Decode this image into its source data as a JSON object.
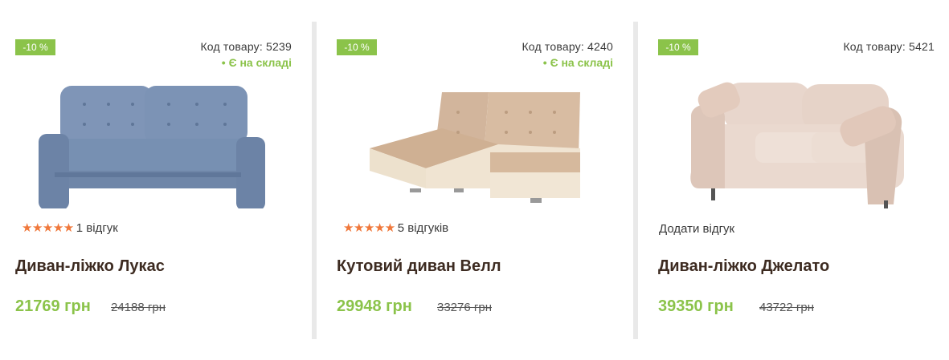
{
  "products": [
    {
      "discount": "-10 %",
      "code": "Код товару: 5239",
      "stock": "Є на складі",
      "stars": "★★★★★",
      "reviews": "1 відгук",
      "title": "Диван-ліжко Лукас",
      "price": "21769 грн",
      "old_price": "24188 грн"
    },
    {
      "discount": "-10 %",
      "code": "Код товару: 4240",
      "stock": "Є на складі",
      "stars": "★★★★★",
      "reviews": "5 відгуків",
      "title": "Кутовий диван Велл",
      "price": "29948 грн",
      "old_price": "33276 грн"
    },
    {
      "discount": "-10 %",
      "code": "Код товару: 5421",
      "add_review": "Додати відгук",
      "title": "Диван-ліжко Джелато",
      "price": "39350 грн",
      "old_price": "43722 грн"
    }
  ],
  "colors": {
    "accent_green": "#8bc34a",
    "star_orange": "#f0783b",
    "title_brown": "#3d2b21",
    "divider_gray": "#e9e9e9"
  }
}
